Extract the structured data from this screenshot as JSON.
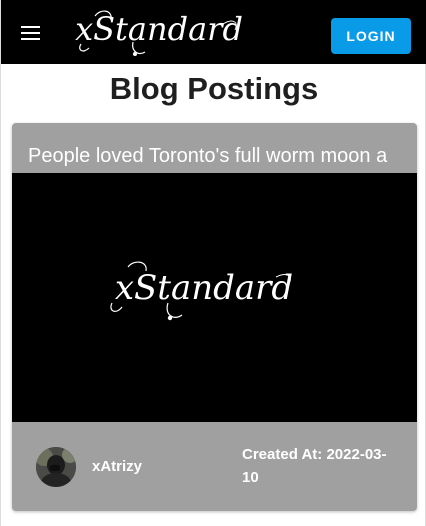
{
  "header": {
    "brand": "xStandard",
    "login_label": "LOGIN"
  },
  "page": {
    "title": "Blog Postings"
  },
  "posts": [
    {
      "title": "People loved Toronto's full worm moon a",
      "image_text": "xStandard",
      "author": "xAtrizy",
      "created": "Created At: 2022-03-10"
    }
  ],
  "colors": {
    "appbar": "#000000",
    "accent": "#0a9be8",
    "card": "#a0a0a0",
    "title": "#1f1f1f"
  }
}
